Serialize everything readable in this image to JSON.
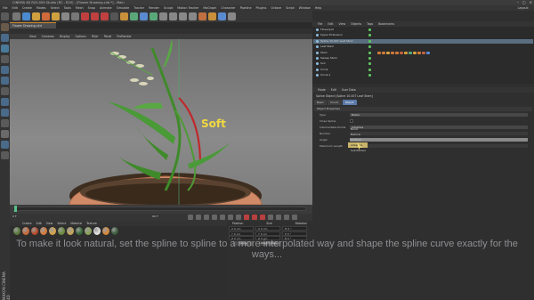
{
  "window": {
    "title": "CINEMA 4D R20.059 Studio (RC - R20) - [Flower Drawing.c4d *] - Main",
    "controls": [
      "–",
      "▢",
      "✕"
    ]
  },
  "menubar": {
    "items": [
      "File",
      "Edit",
      "Create",
      "Modes",
      "Select",
      "Tools",
      "Mesh",
      "Snap",
      "Animate",
      "Simulate",
      "Tracker",
      "Render",
      "Sculpt",
      "Motion Tracker",
      "MoGraph",
      "Character",
      "Pipeline",
      "Plugins",
      "Octane",
      "Script",
      "Window",
      "Help"
    ],
    "layout_label": "Layout:"
  },
  "viewport": {
    "tab_label": "Flower Drawing.c4d",
    "menu": [
      "View",
      "Cameras",
      "Display",
      "Options",
      "Filter",
      "Panel",
      "ProRender"
    ],
    "annotation": "Soft",
    "annotation_color": "#f2d940",
    "highlight_color": "#c0282c"
  },
  "timeline": {
    "current_frame_label": "0 F",
    "end_label": "90 F"
  },
  "materials": {
    "menu": [
      "Create",
      "Edit",
      "View",
      "Select",
      "Material",
      "Texture"
    ],
    "swatches": [
      "#5a7a3c",
      "#c86a3a",
      "#b54a2a",
      "#d47a3a",
      "#d4a24a",
      "#6a8a3a",
      "#c4a45a",
      "#3a6a3a",
      "#8aa25a",
      "#e0e0e0",
      "#d4883a",
      "#3a5a3a"
    ]
  },
  "coordinates": {
    "headers": [
      "Position",
      "Size",
      "Rotation"
    ],
    "rows": [
      [
        "X  0 cm",
        "X  0 cm",
        "H  0 °"
      ],
      [
        "Y  0 cm",
        "Y  0 cm",
        "P  0 °"
      ],
      [
        "Z  0 cm",
        "Z  0 cm",
        "B  0 °"
      ]
    ],
    "world_select": "Object (Rel)",
    "apply_label": "Apply"
  },
  "object_manager": {
    "menu": [
      "File",
      "Edit",
      "View",
      "Objects",
      "Tags",
      "Bookmarks"
    ],
    "rows": [
      {
        "name": "Flowerpot",
        "tag_count": 0
      },
      {
        "name": "Upper Extension",
        "tag_count": 0
      },
      {
        "name": "Spline 10.007 Leaf Stem",
        "tag_count": 0
      },
      {
        "name": "Leaf Stem",
        "tag_count": 0
      },
      {
        "name": "Stem",
        "tag_count": 12
      },
      {
        "name": "Sweep Stem",
        "tag_count": 0
      },
      {
        "name": "Soil",
        "tag_count": 0
      },
      {
        "name": "Circle",
        "tag_count": 0
      },
      {
        "name": "Circle.1",
        "tag_count": 0
      }
    ]
  },
  "attributes": {
    "menu": [
      "Mode",
      "Edit",
      "User Data"
    ],
    "title": "Spline Object [Spline 10.007 Leaf Stem]",
    "tabs": [
      "Basic",
      "Coord.",
      "Object"
    ],
    "active_tab": "Object",
    "section": "Object Properties",
    "rows": [
      {
        "label": "Type",
        "value": "Bezier"
      },
      {
        "label": "Close Spline",
        "value": ""
      },
      {
        "label": "Intermediate Points",
        "value": "Adaptive"
      },
      {
        "label": "Number",
        "value": ""
      },
      {
        "label": "Angle",
        "value": ""
      },
      {
        "label": "Maximum Length",
        "value": ""
      }
    ],
    "dropdown_options": [
      "None",
      "Natural",
      "Uniform",
      "Adaptive",
      "Subdivided"
    ],
    "dropdown_hover": "Adaptive"
  },
  "subtitle": "To make it look natural, set the spline to spline to a more interpolated way and shape the spline curve exactly for the ways...",
  "watermark": "MAXON CINEMA 4D"
}
